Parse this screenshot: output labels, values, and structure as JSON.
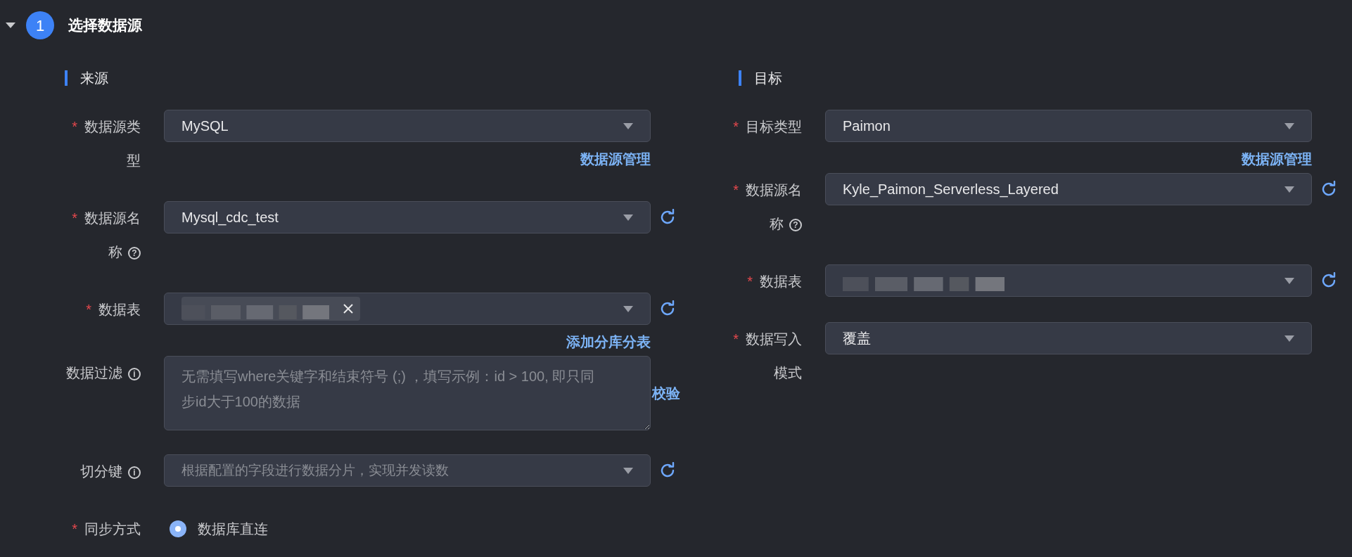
{
  "section": {
    "expanded": true,
    "step": "1",
    "title": "选择数据源"
  },
  "columns": [
    {
      "title": "来源",
      "fields": [
        {
          "kind": "select",
          "label": "数据源类型",
          "required_mark": "*",
          "value": "MySQL",
          "link": "数据源管理"
        },
        {
          "kind": "select",
          "label": "数据源名称",
          "required_mark": "*",
          "help_icon": "?",
          "value": "Mysql_cdc_test",
          "refresh": true
        },
        {
          "kind": "tag_select",
          "label": "数据表",
          "required_mark": "*",
          "refresh": true,
          "link": "添加分库分表"
        },
        {
          "kind": "textarea",
          "label": "数据过滤",
          "help_icon": "i",
          "placeholder": "无需填写where关键字和结束符号 (;) ，填写示例：id > 100, 即只同步id大于100的数据",
          "side_link": "校验"
        },
        {
          "kind": "select",
          "label": "切分键",
          "help_icon": "i",
          "placeholder": "根据配置的字段进行数据分片，实现并发读数",
          "refresh": true
        },
        {
          "kind": "radio",
          "label": "同步方式",
          "required_mark": "*",
          "options": [
            {
              "label": "数据库直连",
              "selected": true
            }
          ]
        }
      ]
    },
    {
      "title": "目标",
      "fields": [
        {
          "kind": "select",
          "label": "目标类型",
          "required_mark": "*",
          "value": "Paimon",
          "link": "数据源管理"
        },
        {
          "kind": "select",
          "label": "数据源名称",
          "required_mark": "*",
          "help_icon": "?",
          "value": "Kyle_Paimon_Serverless_Layered",
          "refresh": true
        },
        {
          "kind": "blurred_select",
          "label": "数据表",
          "required_mark": "*",
          "refresh": true
        },
        {
          "kind": "select",
          "label": "数据写入模式",
          "required_mark": "*",
          "value": "覆盖"
        }
      ]
    }
  ]
}
